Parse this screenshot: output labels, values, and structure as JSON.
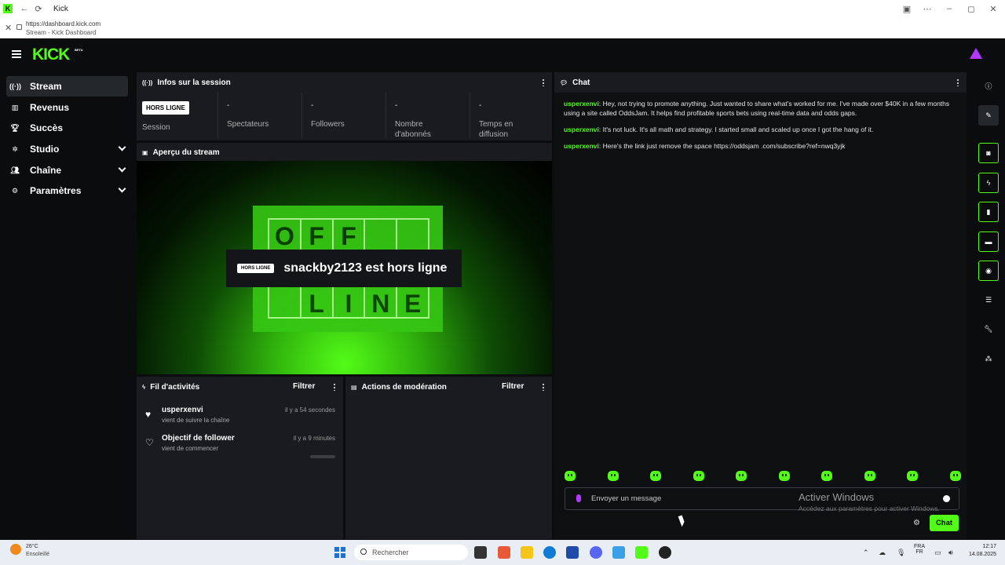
{
  "browser": {
    "tab_title": "Kick",
    "url": "https://dashboard.kick.com",
    "page_title": "Stream - Kick Dashboard"
  },
  "brand": {
    "logo": "KICK",
    "beta": "BETA",
    "accent": "#53fc18",
    "purple": "#b338ff"
  },
  "sidebar": {
    "items": [
      {
        "label": "Stream",
        "icon": "broadcast-icon"
      },
      {
        "label": "Revenus",
        "icon": "chart-icon"
      },
      {
        "label": "Succès",
        "icon": "trophy-icon"
      },
      {
        "label": "Studio",
        "icon": "gear-icon"
      },
      {
        "label": "Chaîne",
        "icon": "users-icon"
      },
      {
        "label": "Paramètres",
        "icon": "settings-icon"
      }
    ]
  },
  "session": {
    "title": "Infos sur la session",
    "badge": "HORS LIGNE",
    "session_label": "Session",
    "stats": [
      {
        "value": "-",
        "label": "Spectateurs"
      },
      {
        "value": "-",
        "label": "Followers"
      },
      {
        "value": "-",
        "label": "Nombre d'abonnés"
      },
      {
        "value": "-",
        "label": "Temps en diffusion"
      }
    ]
  },
  "preview": {
    "title": "Aperçu du stream",
    "badge": "HORS LIGNE",
    "message": "snackby2123 est hors ligne",
    "sign_top": [
      "O",
      "F",
      "F",
      "",
      ""
    ],
    "sign_bottom": [
      "",
      "L",
      "I",
      "N",
      "E"
    ]
  },
  "activity": {
    "title": "Fil d'activités",
    "filter": "Filtrer",
    "items": [
      {
        "name": "usperxenvi",
        "sub": "vient de suivre la chaîne",
        "time": "il y a 54 secondes"
      },
      {
        "name": "Objectif de follower",
        "sub": "vient de commencer",
        "time": "il y a 9 minutes",
        "progress": 0
      }
    ]
  },
  "moderation": {
    "title": "Actions de modération",
    "filter": "Filtrer"
  },
  "chat": {
    "title": "Chat",
    "messages": [
      {
        "user": "usperxenvi",
        "text": ": Hey, not trying to promote anything. Just wanted to share what's worked for me. I've made over $40K in a few months using a site called OddsJam. It helps find profitable sports bets using real-time data and odds gaps."
      },
      {
        "user": "usperxenvi",
        "text": ": It's not luck. It's all math and strategy. I started small and scaled up once I got the hang of it."
      },
      {
        "user": "usperxenvi",
        "text": ": Here's the link just remove the space https://oddsjam .com/subscribe?ref=nwq3yjk"
      }
    ],
    "placeholder": "Envoyer un message",
    "send_label": "Chat"
  },
  "watermark": {
    "line1": "Activer Windows",
    "line2": "Accédez aux paramètres pour activer Windows."
  },
  "taskbar": {
    "temp": "26°C",
    "weather": "Ensoleillé",
    "search": "Rechercher",
    "lang1": "FRA",
    "lang2": "FR",
    "time": "12:17",
    "date": "14.08.2025"
  }
}
